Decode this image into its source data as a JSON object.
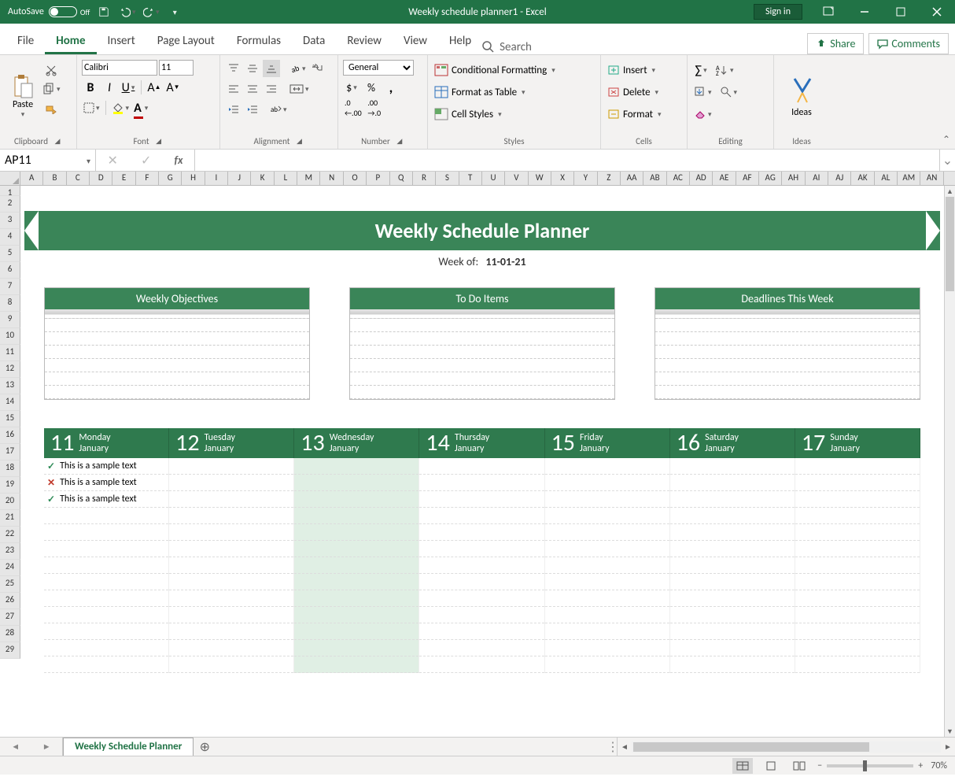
{
  "titlebar": {
    "autosave_label": "AutoSave",
    "autosave_state": "Off",
    "title": "Weekly schedule planner1  -  Excel",
    "sign_in": "Sign in"
  },
  "tabs": {
    "file": "File",
    "home": "Home",
    "insert": "Insert",
    "page_layout": "Page Layout",
    "formulas": "Formulas",
    "data": "Data",
    "review": "Review",
    "view": "View",
    "help": "Help",
    "search": "Search",
    "share": "Share",
    "comments": "Comments"
  },
  "ribbon": {
    "clipboard": {
      "label": "Clipboard",
      "paste": "Paste"
    },
    "font": {
      "label": "Font",
      "name": "Calibri",
      "size": "11"
    },
    "alignment": {
      "label": "Alignment"
    },
    "number": {
      "label": "Number",
      "format": "General"
    },
    "styles": {
      "label": "Styles",
      "cond": "Conditional Formatting",
      "table": "Format as Table",
      "cell": "Cell Styles"
    },
    "cells": {
      "label": "Cells",
      "insert": "Insert",
      "delete": "Delete",
      "format": "Format"
    },
    "editing": {
      "label": "Editing"
    },
    "ideas": {
      "label": "Ideas",
      "btn": "Ideas"
    }
  },
  "namebox": "AP11",
  "columns": [
    "A",
    "B",
    "C",
    "D",
    "E",
    "F",
    "G",
    "H",
    "I",
    "J",
    "K",
    "L",
    "M",
    "N",
    "O",
    "P",
    "Q",
    "R",
    "S",
    "T",
    "U",
    "V",
    "W",
    "X",
    "Y",
    "Z",
    "AA",
    "AB",
    "AC",
    "AD",
    "AE",
    "AF",
    "AG",
    "AH",
    "AI",
    "AJ",
    "AK",
    "AL",
    "AM",
    "AN"
  ],
  "rows_visible": 29,
  "planner": {
    "title": "Weekly Schedule Planner",
    "weekof_label": "Week of:",
    "weekof_date": "11-01-21",
    "cards": [
      "Weekly Objectives",
      "To Do Items",
      "Deadlines This Week"
    ],
    "days": [
      {
        "num": "11",
        "dow": "Monday",
        "mon": "January"
      },
      {
        "num": "12",
        "dow": "Tuesday",
        "mon": "January"
      },
      {
        "num": "13",
        "dow": "Wednesday",
        "mon": "January"
      },
      {
        "num": "14",
        "dow": "Thursday",
        "mon": "January"
      },
      {
        "num": "15",
        "dow": "Friday",
        "mon": "January"
      },
      {
        "num": "16",
        "dow": "Saturday",
        "mon": "January"
      },
      {
        "num": "17",
        "dow": "Sunday",
        "mon": "January"
      }
    ],
    "entries": [
      {
        "mark": "tick",
        "text": "This is a sample text"
      },
      {
        "mark": "cross",
        "text": "This is a sample text"
      },
      {
        "mark": "tick",
        "text": "This is a sample text"
      }
    ]
  },
  "sheet_tab": "Weekly Schedule Planner",
  "zoom": "70%"
}
